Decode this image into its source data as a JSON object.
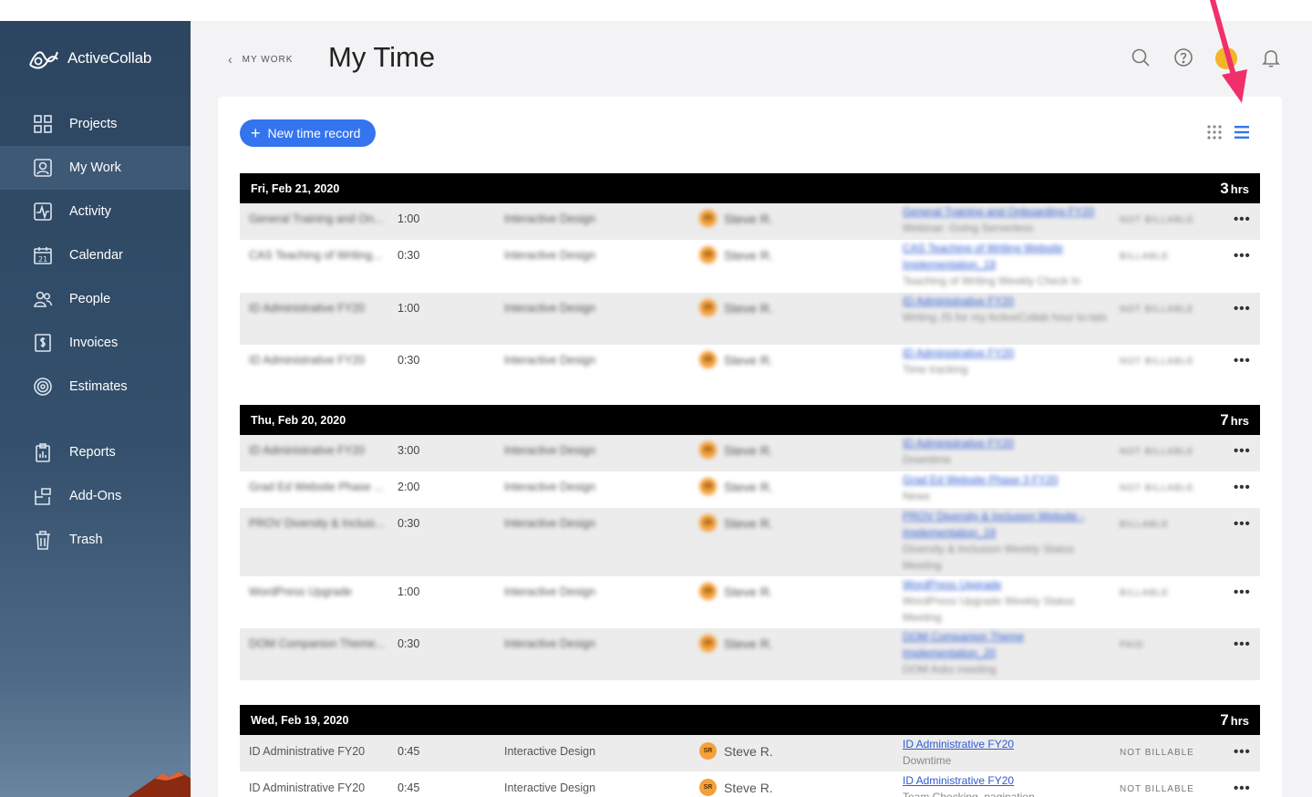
{
  "app": {
    "name": "ActiveCollab"
  },
  "sidebar": {
    "items": [
      {
        "label": "Projects",
        "icon": "grid-icon"
      },
      {
        "label": "My Work",
        "icon": "user-card-icon",
        "active": true
      },
      {
        "label": "Activity",
        "icon": "pulse-icon"
      },
      {
        "label": "Calendar",
        "icon": "calendar-icon",
        "badge": "21"
      },
      {
        "label": "People",
        "icon": "people-icon"
      },
      {
        "label": "Invoices",
        "icon": "invoice-icon"
      },
      {
        "label": "Estimates",
        "icon": "target-icon"
      },
      {
        "label": "Reports",
        "icon": "clipboard-icon"
      },
      {
        "label": "Add-Ons",
        "icon": "addons-icon"
      },
      {
        "label": "Trash",
        "icon": "trash-icon"
      }
    ]
  },
  "header": {
    "breadcrumb": "MY WORK",
    "title": "My Time"
  },
  "toolbar": {
    "new_record_label": "New time record"
  },
  "colors": {
    "accent": "#3474ef",
    "sidebar": "#2c4560",
    "annotation_arrow": "#f0306a",
    "avatar": "#f2b529"
  },
  "days": [
    {
      "date": "Fri, Feb 21, 2020",
      "total": "3",
      "unit": "hrs",
      "entries": [
        {
          "project": "General Training and On...",
          "duration": "1:00",
          "job": "Interactive Design",
          "initials": "SR",
          "user": "Steve R.",
          "task": "General Training and Onboarding FY20",
          "note": "Webinar: Going Serverless",
          "billing": "NOT BILLABLE"
        },
        {
          "project": "CAS Teaching of Writing...",
          "duration": "0:30",
          "job": "Interactive Design",
          "initials": "SR",
          "user": "Steve R.",
          "task": "CAS Teaching of Writing Website Implementation_19",
          "note": "Teaching of Writing Weekly Check In",
          "billing": "BILLABLE"
        },
        {
          "project": "ID Administrative FY20",
          "duration": "1:00",
          "job": "Interactive Design",
          "initials": "SR",
          "user": "Steve R.",
          "task": "ID Administrative FY20",
          "note": "Writing JS for my ActiveCollab hour to-tals",
          "billing": "NOT BILLABLE"
        },
        {
          "project": "ID Administrative FY20",
          "duration": "0:30",
          "job": "Interactive Design",
          "initials": "SR",
          "user": "Steve R.",
          "task": "ID Administrative FY20",
          "note": "Time tracking",
          "billing": "NOT BILLABLE"
        }
      ]
    },
    {
      "date": "Thu, Feb 20, 2020",
      "total": "7",
      "unit": "hrs",
      "entries": [
        {
          "project": "ID Administrative FY20",
          "duration": "3:00",
          "job": "Interactive Design",
          "initials": "SR",
          "user": "Steve R.",
          "task": "ID Administrative FY20",
          "note": "Downtime",
          "billing": "NOT BILLABLE"
        },
        {
          "project": "Grad Ed Website Phase ...",
          "duration": "2:00",
          "job": "Interactive Design",
          "initials": "SR",
          "user": "Steve R.",
          "task": "Grad Ed Website Phase 3 FY20",
          "note": "News",
          "billing": "NOT BILLABLE"
        },
        {
          "project": "PROV Diversity & Inclusi...",
          "duration": "0:30",
          "job": "Interactive Design",
          "initials": "SR",
          "user": "Steve R.",
          "task": "PROV Diversity & Inclusion Website - Implementation_19",
          "note": "Diversity & Inclusion Weekly Status Meeting",
          "billing": "BILLABLE"
        },
        {
          "project": "WordPress Upgrade",
          "duration": "1:00",
          "job": "Interactive Design",
          "initials": "SR",
          "user": "Steve R.",
          "task": "WordPress Upgrade",
          "note": "WordPress Upgrade Weekly Status Meeting",
          "billing": "BILLABLE"
        },
        {
          "project": "DOM Companion Theme...",
          "duration": "0:30",
          "job": "Interactive Design",
          "initials": "SR",
          "user": "Steve R.",
          "task": "DOM Companion Theme Implementation_20",
          "note": "DOM Asks meeting",
          "billing": "PAID"
        }
      ]
    },
    {
      "date": "Wed, Feb 19, 2020",
      "total": "7",
      "unit": "hrs",
      "entries": [
        {
          "project": "ID Administrative FY20",
          "duration": "0:45",
          "job": "Interactive Design",
          "initials": "SR",
          "user": "Steve R.",
          "task": "ID Administrative FY20",
          "note": "Downtime",
          "billing": "NOT BILLABLE"
        },
        {
          "project": "ID Administrative FY20",
          "duration": "0:45",
          "job": "Interactive Design",
          "initials": "SR",
          "user": "Steve R.",
          "task": "ID Administrative FY20",
          "note": "Team Checking, pagination",
          "billing": "NOT BILLABLE"
        }
      ]
    }
  ]
}
